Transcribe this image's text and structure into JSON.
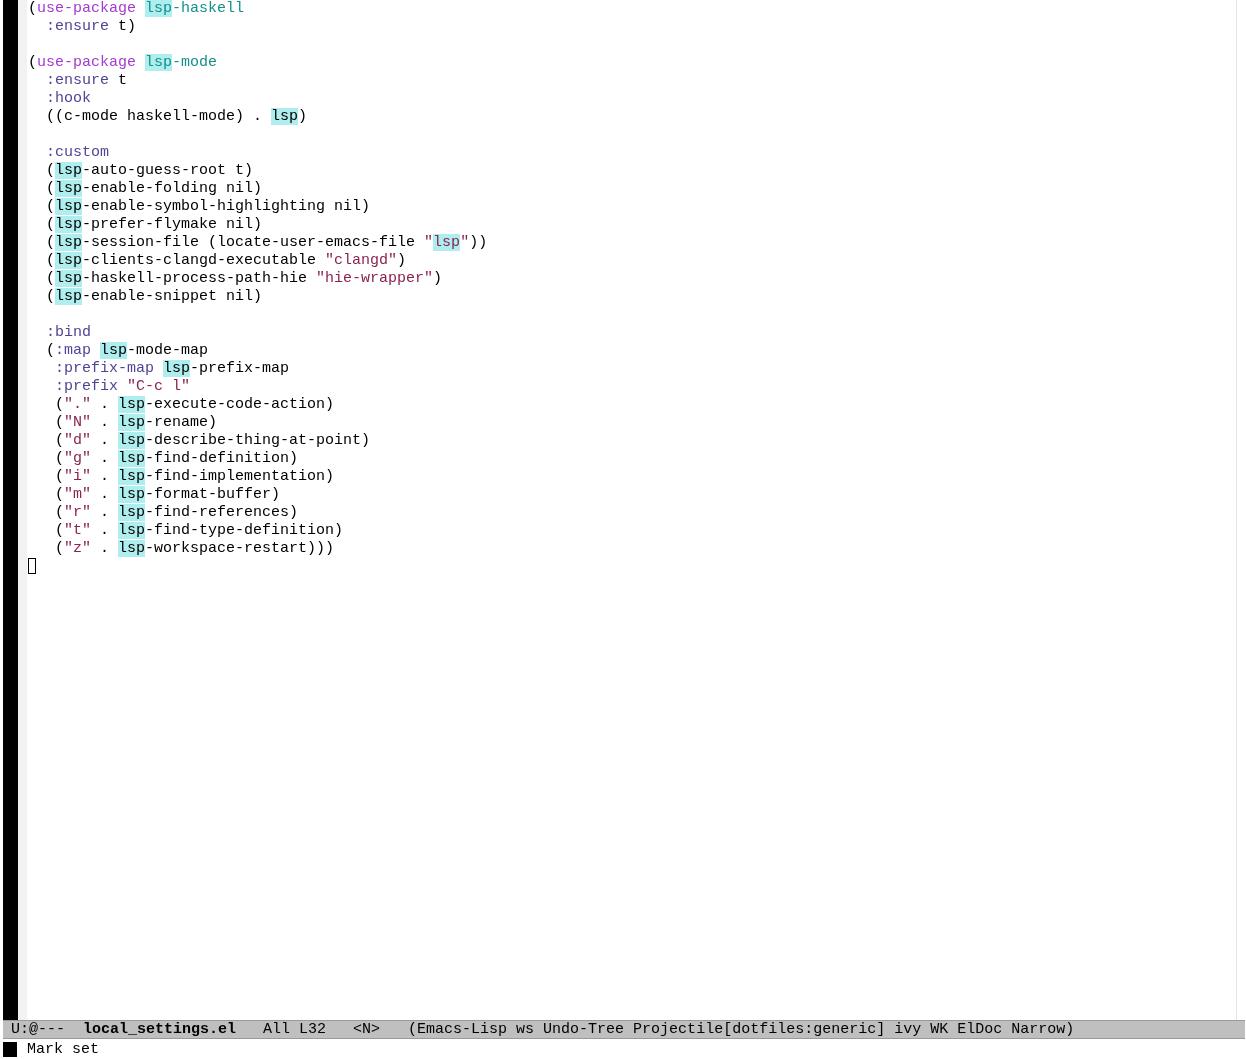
{
  "buffer": {
    "blocks": [
      {
        "lines": [
          {
            "segments": [
              {
                "text": "(",
                "kind": "plain"
              },
              {
                "text": "use-package ",
                "kind": "keyword"
              },
              {
                "text": "lsp",
                "kind": "package-symbol"
              },
              {
                "text": "-haskell",
                "kind": "package"
              }
            ]
          },
          {
            "segments": [
              {
                "text": "  :ensure",
                "kind": "constant"
              },
              {
                "text": " t)",
                "kind": "plain"
              }
            ]
          }
        ]
      },
      {
        "lines": [
          {
            "segments": [
              {
                "text": "(",
                "kind": "plain"
              },
              {
                "text": "use-package ",
                "kind": "keyword"
              },
              {
                "text": "lsp",
                "kind": "package-symbol"
              },
              {
                "text": "-mode",
                "kind": "package"
              }
            ]
          },
          {
            "segments": [
              {
                "text": "  :ensure",
                "kind": "constant"
              },
              {
                "text": " t",
                "kind": "plain"
              }
            ]
          },
          {
            "segments": [
              {
                "text": "  :hook",
                "kind": "constant"
              }
            ]
          },
          {
            "segments": [
              {
                "text": "  ((c-mode haskell-mode) . ",
                "kind": "plain"
              },
              {
                "text": "lsp",
                "kind": "symbol"
              },
              {
                "text": ")",
                "kind": "plain"
              }
            ]
          }
        ]
      },
      {
        "lines": [
          {
            "segments": [
              {
                "text": "  :custom",
                "kind": "constant"
              }
            ]
          },
          {
            "segments": [
              {
                "text": "  (",
                "kind": "plain"
              },
              {
                "text": "lsp",
                "kind": "symbol"
              },
              {
                "text": "-auto-guess-root t)",
                "kind": "plain"
              }
            ]
          },
          {
            "segments": [
              {
                "text": "  (",
                "kind": "plain"
              },
              {
                "text": "lsp",
                "kind": "symbol"
              },
              {
                "text": "-enable-folding nil)",
                "kind": "plain"
              }
            ]
          },
          {
            "segments": [
              {
                "text": "  (",
                "kind": "plain"
              },
              {
                "text": "lsp",
                "kind": "symbol"
              },
              {
                "text": "-enable-symbol-highlighting nil)",
                "kind": "plain"
              }
            ]
          },
          {
            "segments": [
              {
                "text": "  (",
                "kind": "plain"
              },
              {
                "text": "lsp",
                "kind": "symbol"
              },
              {
                "text": "-prefer-flymake nil)",
                "kind": "plain"
              }
            ]
          },
          {
            "segments": [
              {
                "text": "  (",
                "kind": "plain"
              },
              {
                "text": "lsp",
                "kind": "symbol"
              },
              {
                "text": "-session-file (locate-user-emacs-file ",
                "kind": "plain"
              },
              {
                "text": "\"",
                "kind": "string"
              },
              {
                "text": "lsp",
                "kind": "string-symbol"
              },
              {
                "text": "\"",
                "kind": "string"
              },
              {
                "text": "))",
                "kind": "plain"
              }
            ]
          },
          {
            "segments": [
              {
                "text": "  (",
                "kind": "plain"
              },
              {
                "text": "lsp",
                "kind": "symbol"
              },
              {
                "text": "-clients-clangd-executable ",
                "kind": "plain"
              },
              {
                "text": "\"clangd\"",
                "kind": "string"
              },
              {
                "text": ")",
                "kind": "plain"
              }
            ]
          },
          {
            "segments": [
              {
                "text": "  (",
                "kind": "plain"
              },
              {
                "text": "lsp",
                "kind": "symbol"
              },
              {
                "text": "-haskell-process-path-hie ",
                "kind": "plain"
              },
              {
                "text": "\"hie-wrapper\"",
                "kind": "string"
              },
              {
                "text": ")",
                "kind": "plain"
              }
            ]
          },
          {
            "segments": [
              {
                "text": "  (",
                "kind": "plain"
              },
              {
                "text": "lsp",
                "kind": "symbol"
              },
              {
                "text": "-enable-snippet nil)",
                "kind": "plain"
              }
            ]
          }
        ]
      },
      {
        "lines": [
          {
            "segments": [
              {
                "text": "  :bind",
                "kind": "constant"
              }
            ]
          },
          {
            "segments": [
              {
                "text": "  (",
                "kind": "plain"
              },
              {
                "text": ":map ",
                "kind": "constant"
              },
              {
                "text": "lsp",
                "kind": "symbol"
              },
              {
                "text": "-mode-map",
                "kind": "plain"
              }
            ]
          },
          {
            "segments": [
              {
                "text": "   :prefix-map ",
                "kind": "constant"
              },
              {
                "text": "lsp",
                "kind": "symbol"
              },
              {
                "text": "-prefix-map",
                "kind": "plain"
              }
            ]
          },
          {
            "segments": [
              {
                "text": "   :prefix ",
                "kind": "constant"
              },
              {
                "text": "\"C-c l\"",
                "kind": "string"
              }
            ]
          },
          {
            "segments": [
              {
                "text": "   (",
                "kind": "plain"
              },
              {
                "text": "\".\"",
                "kind": "string"
              },
              {
                "text": " . ",
                "kind": "plain"
              },
              {
                "text": "lsp",
                "kind": "symbol"
              },
              {
                "text": "-execute-code-action)",
                "kind": "plain"
              }
            ]
          },
          {
            "segments": [
              {
                "text": "   (",
                "kind": "plain"
              },
              {
                "text": "\"N\"",
                "kind": "string"
              },
              {
                "text": " . ",
                "kind": "plain"
              },
              {
                "text": "lsp",
                "kind": "symbol"
              },
              {
                "text": "-rename)",
                "kind": "plain"
              }
            ]
          },
          {
            "segments": [
              {
                "text": "   (",
                "kind": "plain"
              },
              {
                "text": "\"d\"",
                "kind": "string"
              },
              {
                "text": " . ",
                "kind": "plain"
              },
              {
                "text": "lsp",
                "kind": "symbol"
              },
              {
                "text": "-describe-thing-at-point)",
                "kind": "plain"
              }
            ]
          },
          {
            "segments": [
              {
                "text": "   (",
                "kind": "plain"
              },
              {
                "text": "\"g\"",
                "kind": "string"
              },
              {
                "text": " . ",
                "kind": "plain"
              },
              {
                "text": "lsp",
                "kind": "symbol"
              },
              {
                "text": "-find-definition)",
                "kind": "plain"
              }
            ]
          },
          {
            "segments": [
              {
                "text": "   (",
                "kind": "plain"
              },
              {
                "text": "\"i\"",
                "kind": "string"
              },
              {
                "text": " . ",
                "kind": "plain"
              },
              {
                "text": "lsp",
                "kind": "symbol"
              },
              {
                "text": "-find-implementation)",
                "kind": "plain"
              }
            ]
          },
          {
            "segments": [
              {
                "text": "   (",
                "kind": "plain"
              },
              {
                "text": "\"m\"",
                "kind": "string"
              },
              {
                "text": " . ",
                "kind": "plain"
              },
              {
                "text": "lsp",
                "kind": "symbol"
              },
              {
                "text": "-format-buffer)",
                "kind": "plain"
              }
            ]
          },
          {
            "segments": [
              {
                "text": "   (",
                "kind": "plain"
              },
              {
                "text": "\"r\"",
                "kind": "string"
              },
              {
                "text": " . ",
                "kind": "plain"
              },
              {
                "text": "lsp",
                "kind": "symbol"
              },
              {
                "text": "-find-references)",
                "kind": "plain"
              }
            ]
          },
          {
            "segments": [
              {
                "text": "   (",
                "kind": "plain"
              },
              {
                "text": "\"t\"",
                "kind": "string"
              },
              {
                "text": " . ",
                "kind": "plain"
              },
              {
                "text": "lsp",
                "kind": "symbol"
              },
              {
                "text": "-find-type-definition)",
                "kind": "plain"
              }
            ]
          },
          {
            "segments": [
              {
                "text": "   (",
                "kind": "plain"
              },
              {
                "text": "\"z\"",
                "kind": "string"
              },
              {
                "text": " . ",
                "kind": "plain"
              },
              {
                "text": "lsp",
                "kind": "symbol"
              },
              {
                "text": "-workspace-restart)))",
                "kind": "plain"
              }
            ]
          }
        ]
      }
    ],
    "cursor": {
      "visible": true
    }
  },
  "mode_line": {
    "status": "U:@---",
    "buffer_name": "local_settings.el",
    "position": "All L32",
    "evil_state": "<N>",
    "modes": "(Emacs-Lisp ws Undo-Tree Projectile[dotfiles:generic] ivy WK ElDoc Narrow)"
  },
  "echo_area": {
    "message": "Mark set"
  }
}
